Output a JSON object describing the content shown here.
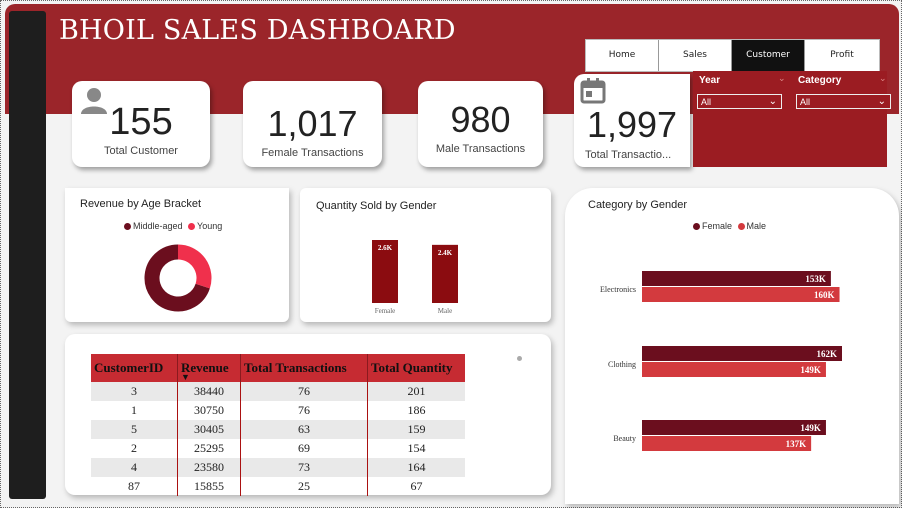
{
  "dashboard": {
    "title": "BHOIL SALES DASHBOARD"
  },
  "nav": {
    "tabs": [
      "Home",
      "Sales",
      "Customer",
      "Profit"
    ],
    "active": "Customer"
  },
  "kpis": [
    {
      "value": "155",
      "label": "Total Customer",
      "icon": "person-icon"
    },
    {
      "value": "1,017",
      "label": "Female Transactions"
    },
    {
      "value": "980",
      "label": "Male Transactions"
    },
    {
      "value": "1,997",
      "label": "Total Transactio...",
      "icon": "calendar-icon"
    }
  ],
  "filters": {
    "year": {
      "label": "Year",
      "value": "All"
    },
    "category": {
      "label": "Category",
      "value": "All"
    }
  },
  "colors": {
    "banner": "#9b252a",
    "middle_aged": "#6b0e1e",
    "young": "#f0304c",
    "female": "#6b0e1e",
    "male": "#d33a3e"
  },
  "donut": {
    "title": "Revenue by Age Bracket",
    "legend": [
      "Middle-aged",
      "Young"
    ]
  },
  "gender_qty": {
    "title": "Quantity Sold by Gender"
  },
  "category_gender": {
    "title": "Category by Gender",
    "legend": [
      "Female",
      "Male"
    ]
  },
  "chart_data": [
    {
      "type": "pie",
      "title": "Revenue by Age Bracket",
      "categories": [
        "Middle-aged",
        "Young"
      ],
      "values": [
        70,
        30
      ]
    },
    {
      "type": "bar",
      "title": "Quantity Sold by Gender",
      "categories": [
        "Female",
        "Male"
      ],
      "values": [
        2600,
        2400
      ],
      "labels": [
        "2.6K",
        "2.4K"
      ]
    },
    {
      "type": "bar",
      "title": "Category by Gender",
      "categories": [
        "Electronics",
        "Clothing",
        "Beauty"
      ],
      "series": [
        {
          "name": "Female",
          "values": [
            153000,
            162000,
            149000
          ],
          "labels": [
            "153K",
            "162K",
            "149K"
          ]
        },
        {
          "name": "Male",
          "values": [
            160000,
            149000,
            137000
          ],
          "labels": [
            "160K",
            "149K",
            "137K"
          ]
        }
      ]
    }
  ],
  "table": {
    "columns": [
      "CustomerID",
      "Revenue",
      "Total Transactions",
      "Total Quantity"
    ],
    "rows": [
      [
        "3",
        "38440",
        "76",
        "201"
      ],
      [
        "1",
        "30750",
        "76",
        "186"
      ],
      [
        "5",
        "30405",
        "63",
        "159"
      ],
      [
        "2",
        "25295",
        "69",
        "154"
      ],
      [
        "4",
        "23580",
        "73",
        "164"
      ],
      [
        "87",
        "15855",
        "25",
        "67"
      ]
    ]
  }
}
